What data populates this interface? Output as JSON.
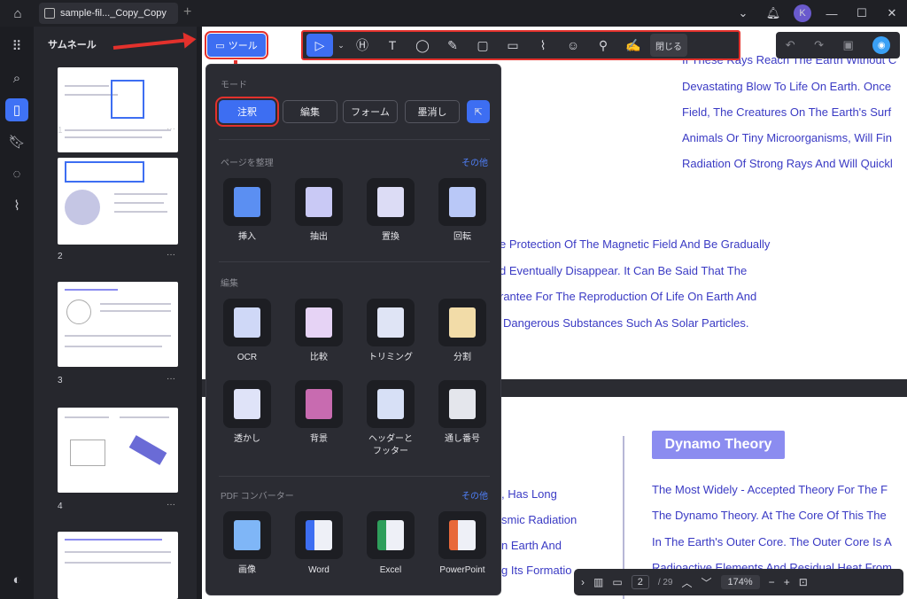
{
  "titlebar": {
    "tab_label": "sample-fil..._Copy_Copy",
    "avatar": "K"
  },
  "sidebar": {
    "title": "サムネール"
  },
  "thumbnails": [
    {
      "num": "1"
    },
    {
      "num": "2"
    },
    {
      "num": "3"
    },
    {
      "num": "4"
    }
  ],
  "tools_button": "ツール",
  "toolbar": {
    "close_label": "閉じる"
  },
  "panel": {
    "mode_title": "モード",
    "modes": [
      "注釈",
      "編集",
      "フォーム",
      "墨消し"
    ],
    "organize_title": "ページを整理",
    "organize_more": "その他",
    "organize_items": [
      "挿入",
      "抽出",
      "置換",
      "回転"
    ],
    "edit_title": "編集",
    "edit_items": [
      "OCR",
      "比較",
      "トリミング",
      "分割",
      "透かし",
      "背景",
      "ヘッダーと\nフッター",
      "通し番号"
    ],
    "converter_title": "PDF コンバーター",
    "converter_more": "その他",
    "converter_items": [
      "画像",
      "Word",
      "Excel",
      "PowerPoint"
    ]
  },
  "document": {
    "lines_right": [
      "If These Rays Reach The Earth Without C",
      "Devastating Blow To Life On Earth. Once",
      "Field, The Creatures On The Earth's Surf",
      "Animals Or Tiny Microorganisms, Will Fin",
      "Radiation Of Strong Rays And Will Quickl"
    ],
    "lines_mid": [
      "e Protection Of The Magnetic Field And Be Gradually",
      "d Eventually Disappear. It Can Be Said That The",
      "rantee For The Reproduction Of Life On Earth And",
      "Dangerous Substances Such As Solar Particles."
    ],
    "dynamo_title": "Dynamo Theory",
    "dynamo_lines": [
      "The Most Widely - Accepted Theory For The F",
      "The Dynamo Theory. At The Core Of This The",
      "In The Earth's Outer Core. The Outer Core Is A",
      "Radioactive Elements And Residual Heat From"
    ],
    "left_lines": [
      ", Has Long",
      "smic Radiation",
      "n Earth And",
      "g Its Formatio"
    ]
  },
  "bottombar": {
    "page": "2",
    "total": "/ 29",
    "zoom": "174%"
  }
}
